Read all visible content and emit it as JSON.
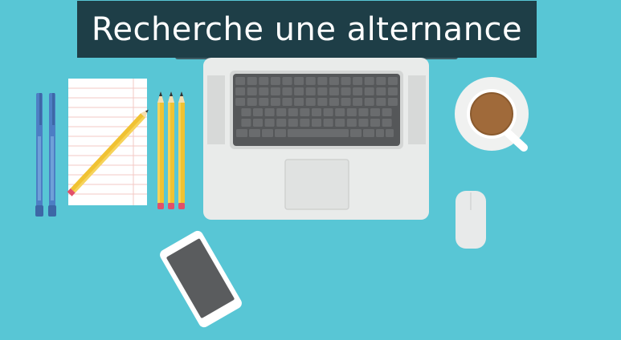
{
  "banner": {
    "title": "Recherche une alternance"
  },
  "colors": {
    "background": "#58c6d5",
    "banner": "#1e3e47",
    "laptop_body": "#e9ebea",
    "keyboard": "#555759",
    "coffee": "#a06a3a",
    "pencil": "#f0c232",
    "pen": "#4d7ec4"
  },
  "icons": {
    "pens": "pen-icon",
    "notepad": "notepad-icon",
    "pencils": "pencil-icon",
    "laptop": "laptop-icon",
    "coffee": "coffee-cup-icon",
    "mouse": "mouse-icon",
    "phone": "smartphone-icon"
  }
}
